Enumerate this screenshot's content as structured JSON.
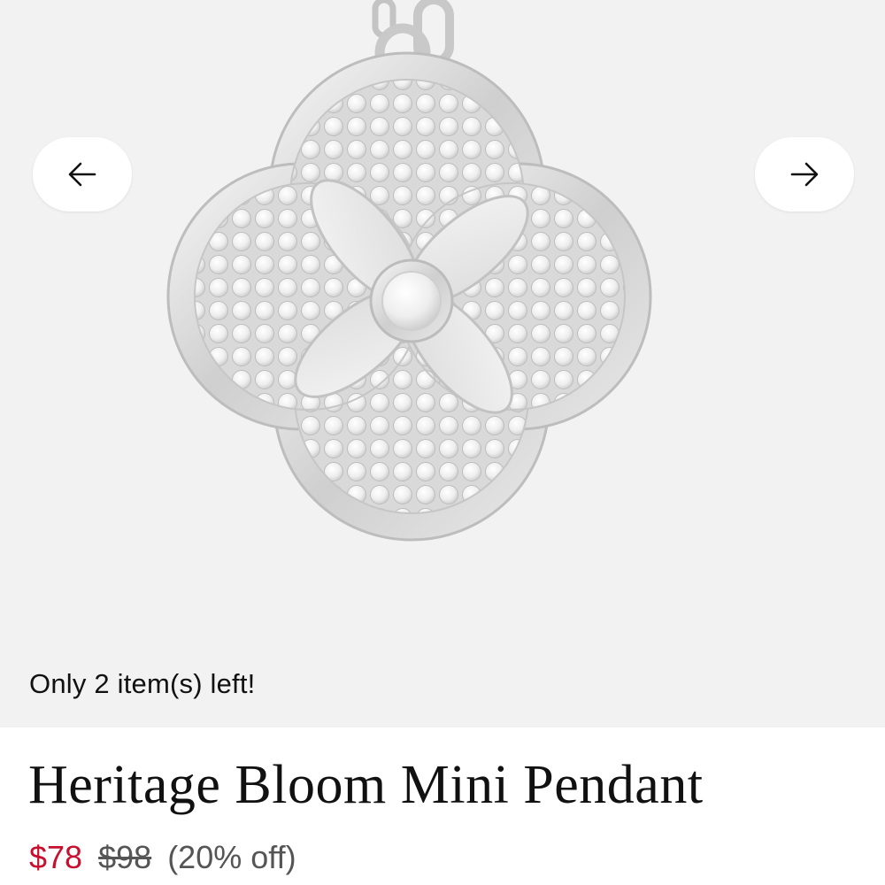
{
  "gallery": {
    "image_alt": "Heritage Bloom Mini Pendant",
    "prev_icon": "arrow-left-icon",
    "next_icon": "arrow-right-icon"
  },
  "stock": {
    "message": "Only 2 item(s) left!"
  },
  "product": {
    "title": "Heritage Bloom Mini Pendant",
    "price_sale": "$78",
    "price_original": "$98",
    "discount": "(20% off)"
  },
  "colors": {
    "sale_price": "#c8102e",
    "text": "#111111",
    "muted": "#555555"
  }
}
